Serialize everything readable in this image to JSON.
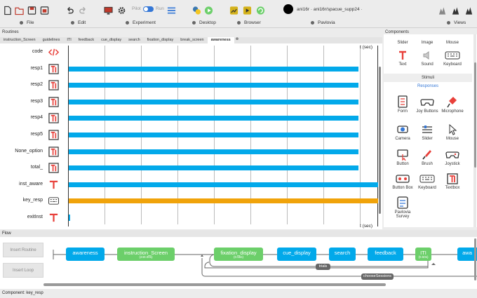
{
  "toolbar": {
    "pilot_label": "Pilot",
    "run_label": "Run",
    "user_text": "ani16r  ·  ani16r/spacue_supp24  ·",
    "menus": [
      {
        "label": "File"
      },
      {
        "label": "Edit"
      },
      {
        "label": "Experiment"
      },
      {
        "label": "Desktop"
      },
      {
        "label": "Browser"
      },
      {
        "label": "Pavlovia"
      },
      {
        "label": "Views"
      }
    ]
  },
  "routines_header": "Routines",
  "components_header": "Components",
  "tabs": [
    "instruction_Screen",
    "guidelines",
    "ITI",
    "feedback",
    "cue_display",
    "search",
    "fixation_display",
    "break_screen",
    "awareness"
  ],
  "active_tab": "awareness",
  "tab_close": "⊗",
  "timeline": {
    "unit_label": "t (sec)",
    "rows": [
      {
        "label": "code",
        "icon": "code-icon",
        "bar": null
      },
      {
        "label": "resp1",
        "icon": "textbox-icon",
        "bar": "blue"
      },
      {
        "label": "resp2",
        "icon": "textbox-icon",
        "bar": "blue"
      },
      {
        "label": "resp3",
        "icon": "textbox-icon",
        "bar": "blue"
      },
      {
        "label": "resp4",
        "icon": "textbox-icon",
        "bar": "blue"
      },
      {
        "label": "resp5",
        "icon": "textbox-icon",
        "bar": "blue"
      },
      {
        "label": "None_option",
        "icon": "textbox-icon",
        "bar": "blue"
      },
      {
        "label": "total_",
        "icon": "textbox-icon",
        "bar": "blue"
      },
      {
        "label": "inst_aware",
        "icon": "text-icon",
        "bar": "blue-full"
      },
      {
        "label": "key_resp",
        "icon": "keyboard-icon",
        "bar": "orange"
      },
      {
        "label": "exitInst",
        "icon": "text-icon",
        "bar": "tick"
      }
    ],
    "colors": {
      "blue": "#02a9ea",
      "orange": "#f0a30a"
    }
  },
  "components": {
    "top_row": [
      {
        "label": "Slider"
      },
      {
        "label": "Image"
      },
      {
        "label": "Mouse"
      }
    ],
    "row2": [
      {
        "label": "Text"
      },
      {
        "label": "Sound"
      },
      {
        "label": "Keyboard"
      }
    ],
    "stimuli_label": "Stimuli",
    "responses_label": "Responses",
    "responses": [
      {
        "label": "Form"
      },
      {
        "label": "Joy Buttons"
      },
      {
        "label": "Microphone"
      },
      {
        "label": "Camera"
      },
      {
        "label": "Slider"
      },
      {
        "label": "Mouse"
      },
      {
        "label": "Button"
      },
      {
        "label": "Brush"
      },
      {
        "label": "Joystick"
      },
      {
        "label": "Button Box"
      },
      {
        "label": "Keyboard"
      },
      {
        "label": "Textbox"
      },
      {
        "label": "Pavlovia Survey"
      }
    ]
  },
  "flow": {
    "header": "Flow",
    "insert_routine": "Insert Routine",
    "insert_loop": "Insert Loop",
    "items": [
      {
        "label": "awareness",
        "sub": "",
        "color": "blue"
      },
      {
        "label": "instruction_Screen",
        "sub": "(240.00s)",
        "color": "green"
      },
      {
        "label": "fixation_display",
        "sub": "(0.55s)",
        "color": "green"
      },
      {
        "label": "cue_display",
        "sub": "",
        "color": "blue"
      },
      {
        "label": "search",
        "sub": "",
        "color": "blue"
      },
      {
        "label": "feedback",
        "sub": "",
        "color": "blue"
      },
      {
        "label": "ITI",
        "sub": "(0.50s)",
        "color": "green"
      },
      {
        "label": "awa",
        "sub": "",
        "color": "blue"
      }
    ],
    "loops": [
      {
        "label": "trials"
      },
      {
        "label": "chooseSessions"
      }
    ]
  },
  "status": "Component: key_resp"
}
